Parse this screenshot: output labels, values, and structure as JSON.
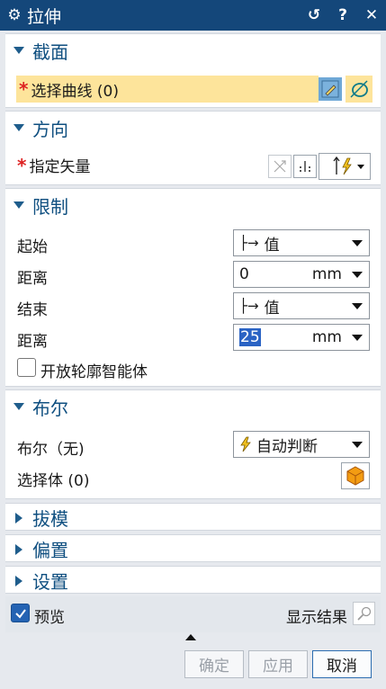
{
  "window": {
    "title": "拉伸",
    "icons": [
      "gear-icon",
      "reset-icon",
      "help-icon",
      "close-icon"
    ],
    "accent": "#14477a"
  },
  "section_profile": {
    "title": "截面",
    "select_curve_label": "选择曲线 (0)"
  },
  "section_direction": {
    "title": "方向",
    "vector_label": "指定矢量"
  },
  "section_limits": {
    "title": "限制",
    "start_label": "起始",
    "start_value": "值",
    "start_dist_label": "距离",
    "start_dist_value": "0",
    "start_dist_unit": "mm",
    "end_label": "结束",
    "end_value": "值",
    "end_dist_label": "距离",
    "end_dist_value": "25",
    "end_dist_unit": "mm",
    "open_profile_label": "开放轮廓智能体",
    "open_profile_checked": false
  },
  "section_boolean": {
    "title": "布尔",
    "boolean_label": "布尔（无)",
    "boolean_value": "自动判断",
    "select_body_label": "选择体 (0)"
  },
  "collapsed_sections": {
    "draft": "拔模",
    "offset": "偏置",
    "settings": "设置"
  },
  "footer": {
    "preview_label": "预览",
    "preview_checked": true,
    "show_result_label": "显示结果",
    "ok_label": "确定",
    "apply_label": "应用",
    "cancel_label": "取消"
  }
}
